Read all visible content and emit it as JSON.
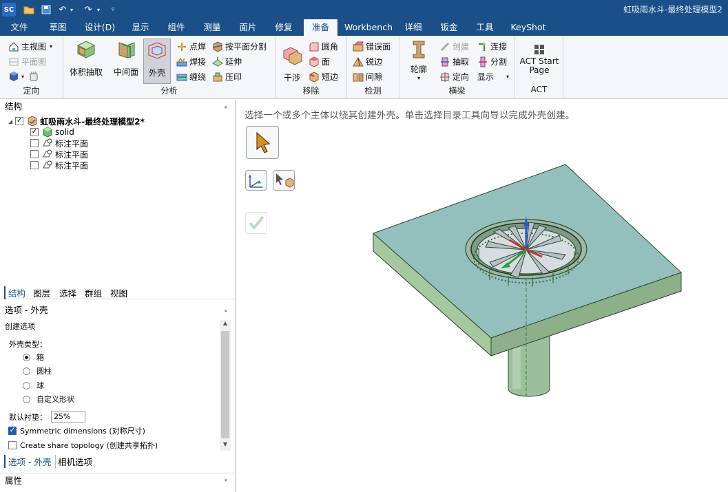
{
  "app": {
    "logo": "SC",
    "title": "虹吸雨水斗-最终处理模型2"
  },
  "menu": {
    "tabs": [
      "文件",
      "草图",
      "设计(D)",
      "显示",
      "组件",
      "测量",
      "面片",
      "修复",
      "准备",
      "Workbench",
      "详细",
      "钣金",
      "工具",
      "KeyShot"
    ],
    "active": "准备"
  },
  "ribbon": {
    "orient": {
      "label": "定向",
      "home": "主视图",
      "plane": "平面图"
    },
    "analysis": {
      "label": "分析",
      "volume": "体积抽取",
      "midsurface": "中间面",
      "shell": "外壳",
      "spot_weld": "点焊",
      "weld": "焊接",
      "wrap": "缠绕",
      "split_by_plane": "按平面分割",
      "extend": "延伸",
      "imprint": "压印"
    },
    "remove": {
      "label": "移除",
      "interference": "干涉",
      "round": "圆角",
      "face": "面",
      "short_edge": "短边"
    },
    "detect": {
      "label": "检测",
      "error_face": "错误面",
      "sharp_edge": "锐边",
      "gap": "间隙"
    },
    "beam": {
      "label": "横梁",
      "profile": "轮廓",
      "create": "创建",
      "extract": "抽取",
      "orient": "定向",
      "connect": "连接",
      "split": "分割",
      "display": "显示"
    },
    "act": {
      "label": "ACT",
      "start_line1": "ACT Start",
      "start_line2": "Page"
    }
  },
  "structure": {
    "header": "结构",
    "root": "虹吸雨水斗-最终处理模型2*",
    "items": [
      {
        "label": "solid",
        "checked": true,
        "icon": "solid-body-icon"
      },
      {
        "label": "标注平面",
        "checked": false,
        "icon": "annotation-plane-icon"
      },
      {
        "label": "标注平面",
        "checked": false,
        "icon": "annotation-plane-icon"
      },
      {
        "label": "标注平面",
        "checked": false,
        "icon": "annotation-plane-icon"
      }
    ]
  },
  "panel_tabs": [
    "结构",
    "图层",
    "选择",
    "群组",
    "视图"
  ],
  "options": {
    "header": "选项 - 外壳",
    "section": "创建选项",
    "shell_type_label": "外壳类型：",
    "types": [
      "箱",
      "圆柱",
      "球",
      "自定义形状"
    ],
    "selected_type": "箱",
    "padding_label": "默认衬垫：",
    "padding_value": "25%",
    "symmetric": "Symmetric dimensions (对称尺寸)",
    "symmetric_checked": true,
    "share_topology": "Create share topology (创建共享拓扑)",
    "share_topology_checked": false
  },
  "bottom_tabs": [
    "选项 - 外壳",
    "相机选项"
  ],
  "properties_header": "属性",
  "viewport": {
    "hint": "选择一个或多个主体以绕其创建外壳。单击选择目录工具向导以完成外壳创建。"
  }
}
